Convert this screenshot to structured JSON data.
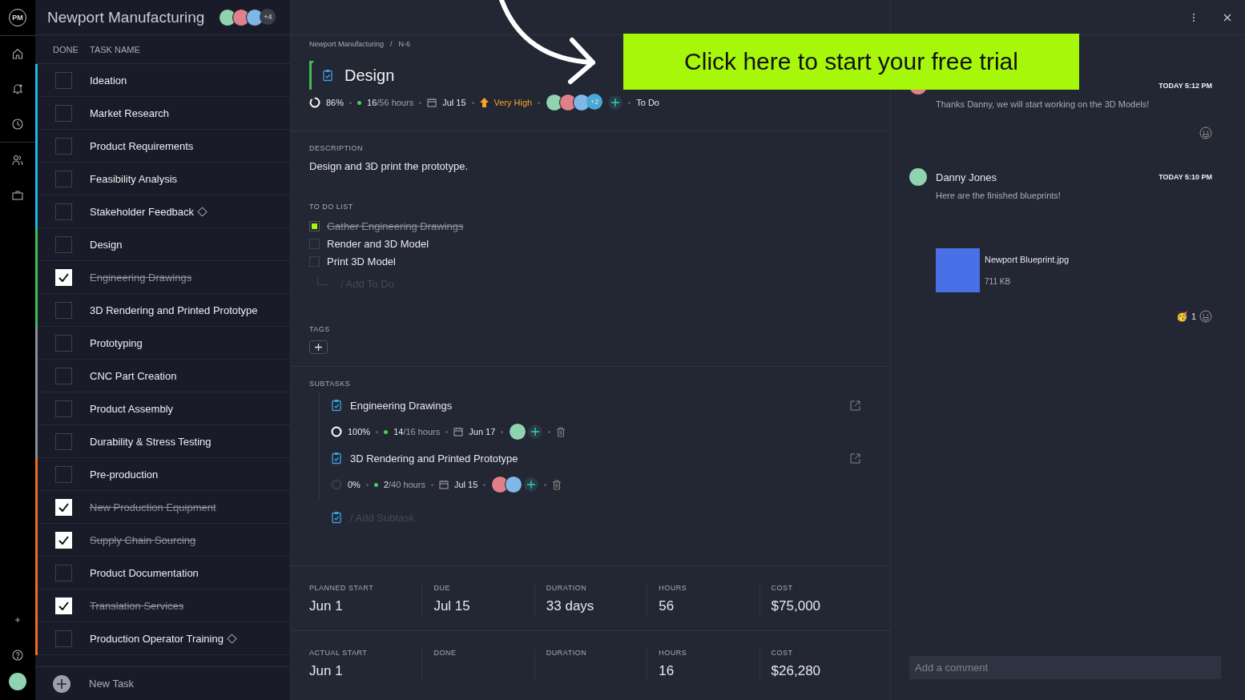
{
  "rail": {
    "logo": "PM"
  },
  "project": {
    "title": "Newport Manufacturing",
    "more_members": "+4"
  },
  "task_list": {
    "columns": [
      "DONE",
      "TASK NAME"
    ],
    "tasks": [
      {
        "name": "Ideation",
        "checked": false,
        "color": "#1fb6e0",
        "kind": "task"
      },
      {
        "name": "Market Research",
        "checked": false,
        "color": "#1fb6e0",
        "kind": "task"
      },
      {
        "name": "Product Requirements",
        "checked": false,
        "color": "#1fb6e0",
        "kind": "task"
      },
      {
        "name": "Feasibility Analysis",
        "checked": false,
        "color": "#1fb6e0",
        "kind": "task"
      },
      {
        "name": "Stakeholder Feedback",
        "checked": false,
        "color": "#1fb6e0",
        "kind": "milestone"
      },
      {
        "name": "Design",
        "checked": false,
        "color": "#3fbf4f",
        "kind": "task"
      },
      {
        "name": "Engineering Drawings",
        "checked": true,
        "color": "#3fbf4f",
        "kind": "task"
      },
      {
        "name": "3D Rendering and Printed Prototype",
        "checked": false,
        "color": "#3fbf4f",
        "kind": "task"
      },
      {
        "name": "Prototyping",
        "checked": false,
        "color": "#8a8f99",
        "kind": "task"
      },
      {
        "name": "CNC Part Creation",
        "checked": false,
        "color": "#8a8f99",
        "kind": "task"
      },
      {
        "name": "Product Assembly",
        "checked": false,
        "color": "#8a8f99",
        "kind": "task"
      },
      {
        "name": "Durability & Stress Testing",
        "checked": false,
        "color": "#8a8f99",
        "kind": "task"
      },
      {
        "name": "Pre-production",
        "checked": false,
        "color": "#f06a25",
        "kind": "task"
      },
      {
        "name": "New Production Equipment",
        "checked": true,
        "color": "#f06a25",
        "kind": "task"
      },
      {
        "name": "Supply Chain Sourcing",
        "checked": true,
        "color": "#f06a25",
        "kind": "task"
      },
      {
        "name": "Product Documentation",
        "checked": false,
        "color": "#f06a25",
        "kind": "task"
      },
      {
        "name": "Translation Services",
        "checked": true,
        "color": "#f06a25",
        "kind": "task"
      },
      {
        "name": "Production Operator Training",
        "checked": false,
        "color": "#f06a25",
        "kind": "milestone"
      }
    ],
    "new_task": "New Task"
  },
  "detail": {
    "breadcrumb": [
      "Newport Manufacturing",
      "/",
      "N-6"
    ],
    "title": "Design",
    "meta": {
      "progress": "86%",
      "hours_done": "16",
      "hours_total": "/56 hours",
      "due": "Jul 15",
      "priority": "Very High",
      "more_assignees": "+2",
      "status": "To Do"
    },
    "description_label": "DESCRIPTION",
    "description": "Design and 3D print the prototype.",
    "todo_label": "TO DO LIST",
    "todos": [
      {
        "text": "Gather Engineering Drawings",
        "checked": true
      },
      {
        "text": "Render and 3D Model",
        "checked": false
      },
      {
        "text": "Print 3D Model",
        "checked": false
      }
    ],
    "add_todo_placeholder": "/ Add To Do",
    "tags_label": "TAGS",
    "subtasks_label": "SUBTASKS",
    "subtasks": [
      {
        "name": "Engineering Drawings",
        "progress": "100%",
        "hours_done": "14",
        "hours_total": "/16 hours",
        "due": "Jun 17"
      },
      {
        "name": "3D Rendering and Printed Prototype",
        "progress": "0%",
        "hours_done": "2",
        "hours_total": "/40 hours",
        "due": "Jul 15"
      }
    ],
    "add_subtask_placeholder": "/ Add Subtask",
    "stats": [
      [
        {
          "label": "PLANNED START",
          "value": "Jun 1"
        },
        {
          "label": "DUE",
          "value": "Jul 15"
        },
        {
          "label": "DURATION",
          "value": "33 days"
        },
        {
          "label": "HOURS",
          "value": "56"
        },
        {
          "label": "COST",
          "value": "$75,000"
        }
      ],
      [
        {
          "label": "ACTUAL START",
          "value": "Jun 1"
        },
        {
          "label": "DONE"
        },
        {
          "label": "DURATION"
        },
        {
          "label": "HOURS",
          "value": "16"
        },
        {
          "label": "COST",
          "value": "$26,280"
        }
      ]
    ]
  },
  "comments": {
    "items": [
      {
        "time": "TODAY 5:12 PM",
        "text": "Thanks Danny, we will start working on the 3D Models!"
      },
      {
        "author": "Danny Jones",
        "time": "TODAY 5:10 PM",
        "text": "Here are the finished blueprints!",
        "attachment": {
          "name": "Newport Blueprint.jpg",
          "size": "711 KB"
        },
        "reaction_emoji": "🥳",
        "reaction_count": "1"
      }
    ],
    "input_placeholder": "Add a comment"
  },
  "banner": {
    "text": "Click here to start your free trial"
  }
}
